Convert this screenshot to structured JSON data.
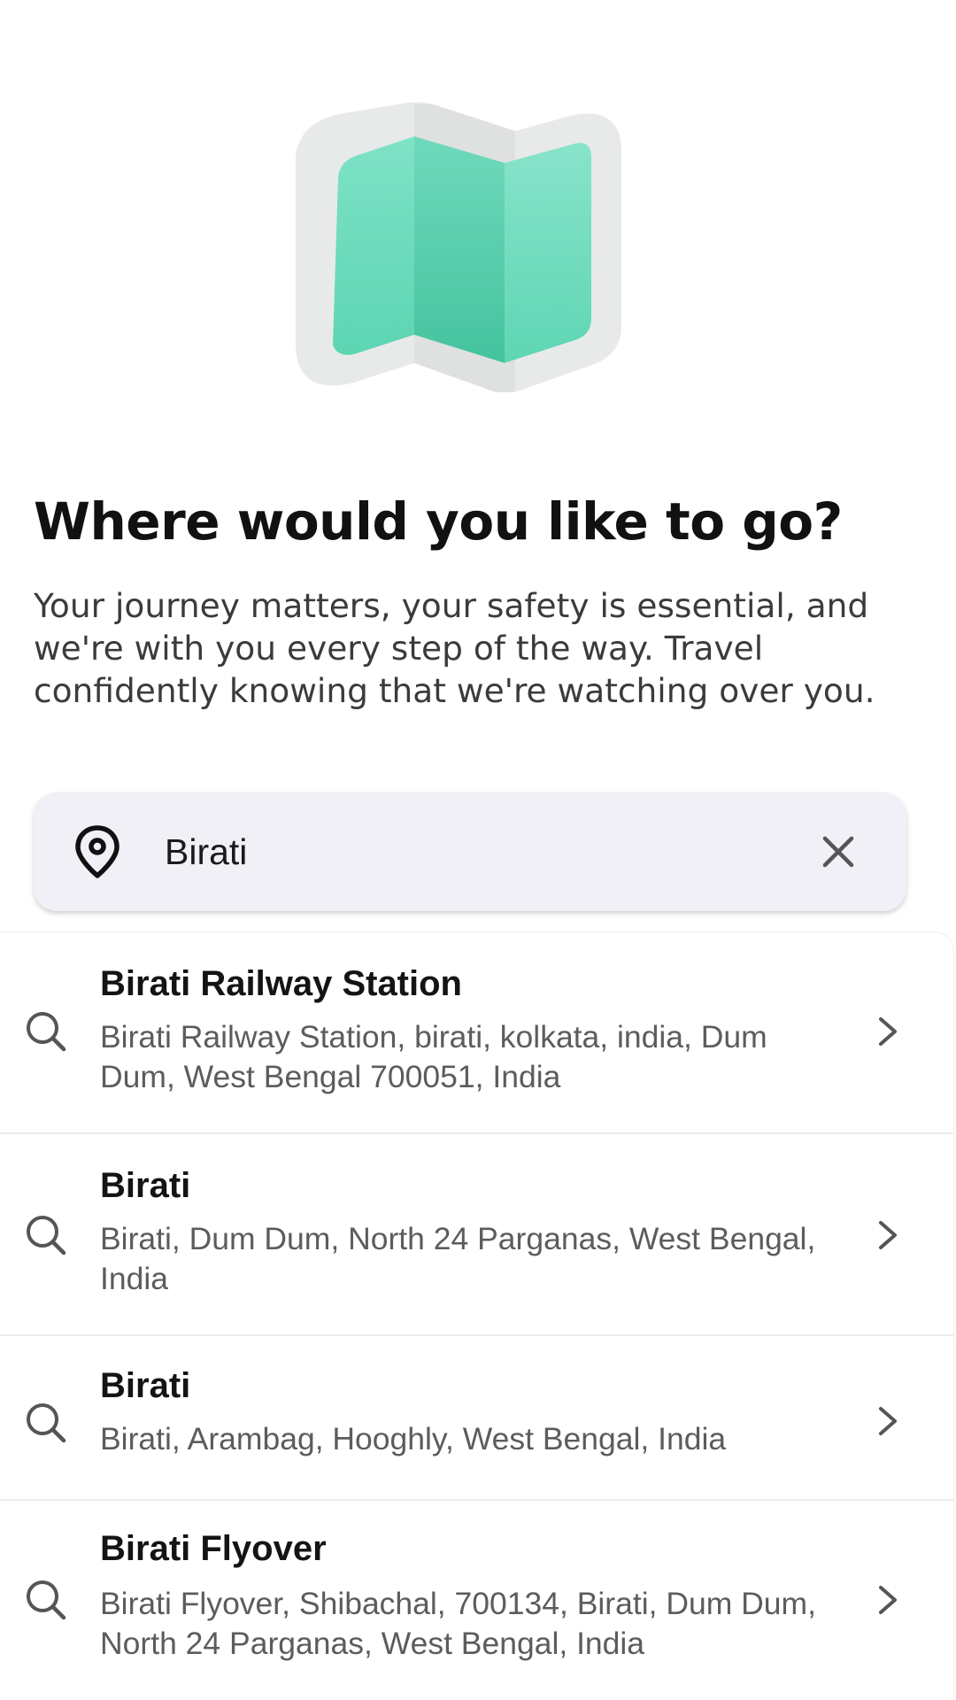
{
  "hero": {
    "icon": "folded-map-icon",
    "colors": {
      "map_green": "#5fd8b6",
      "map_green_dark": "#4cc9a5",
      "frame_gray": "#e6e8e8"
    }
  },
  "heading": {
    "title": "Where would you like to go?",
    "subtitle": "Your journey matters, your safety is essential, and we're with you every step of the way. Travel confidently knowing that we're watching over you."
  },
  "search": {
    "icon": "location-pin-icon",
    "value": "Birati",
    "clear_icon": "close-icon"
  },
  "results": [
    {
      "name": "Birati Railway Station",
      "address": "Birati Railway Station, birati, kolkata, india, Dum Dum, West Bengal 700051, India"
    },
    {
      "name": "Birati",
      "address": "Birati, Dum Dum, North 24 Parganas, West Bengal, India"
    },
    {
      "name": "Birati",
      "address": "Birati, Arambag, Hooghly, West Bengal, India"
    },
    {
      "name": "Birati Flyover",
      "address": "Birati Flyover, Shibachal, 700134, Birati, Dum Dum, North 24 Parganas, West Bengal, India"
    }
  ],
  "result_icons": {
    "leading": "search-icon",
    "trailing": "chevron-right-icon"
  }
}
